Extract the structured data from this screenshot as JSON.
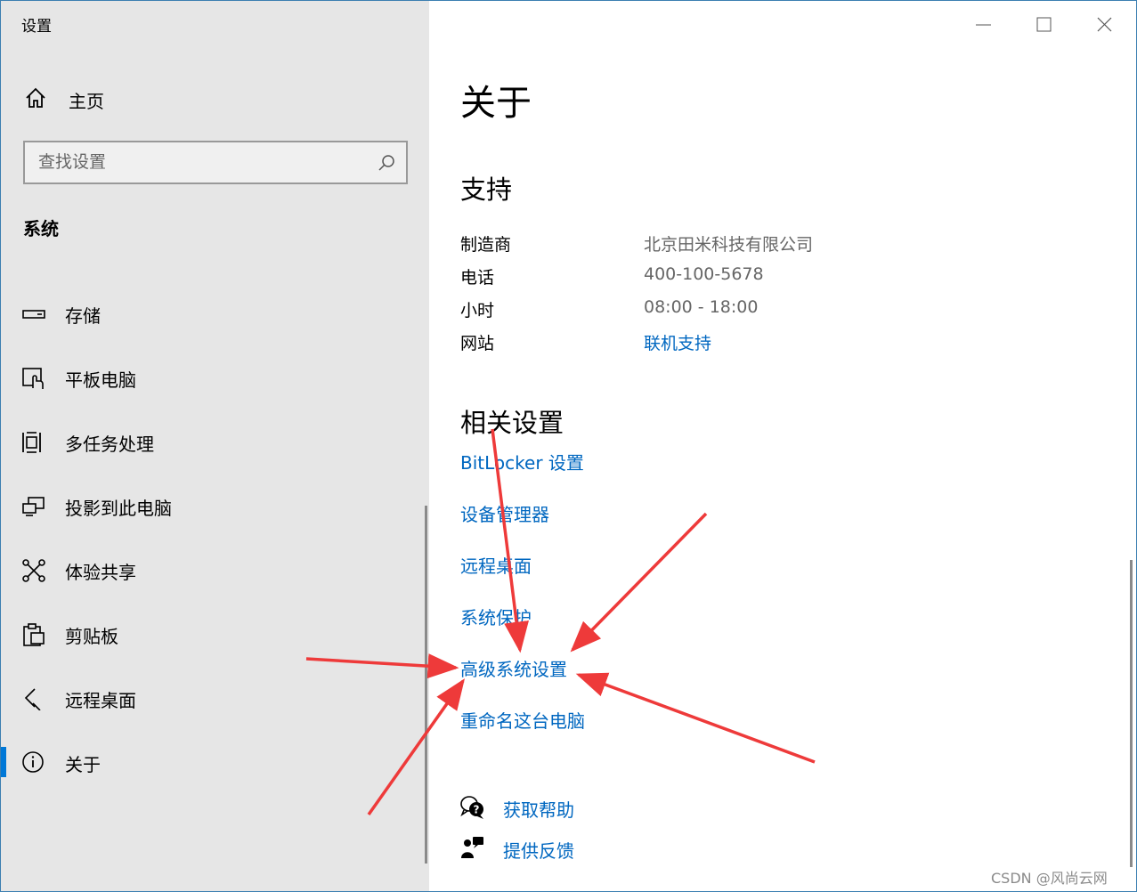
{
  "window": {
    "title": "设置",
    "controls": [
      "minimize-icon",
      "maximize-icon",
      "close-icon"
    ]
  },
  "sidebar": {
    "home_label": "主页",
    "search_placeholder": "查找设置",
    "section_title": "系统",
    "items": [
      {
        "label": "存储",
        "icon": "storage-icon"
      },
      {
        "label": "平板电脑",
        "icon": "tablet-icon"
      },
      {
        "label": "多任务处理",
        "icon": "multitasking-icon"
      },
      {
        "label": "投影到此电脑",
        "icon": "project-icon"
      },
      {
        "label": "体验共享",
        "icon": "shared-experiences-icon"
      },
      {
        "label": "剪贴板",
        "icon": "clipboard-icon"
      },
      {
        "label": "远程桌面",
        "icon": "remote-desktop-icon"
      },
      {
        "label": "关于",
        "icon": "info-icon",
        "active": true
      }
    ]
  },
  "main": {
    "title": "关于",
    "support": {
      "heading": "支持",
      "rows": [
        {
          "key": "制造商",
          "value": "北京田米科技有限公司"
        },
        {
          "key": "电话",
          "value": "400-100-5678"
        },
        {
          "key": "小时",
          "value": "08:00 - 18:00"
        },
        {
          "key": "网站",
          "value": "联机支持"
        }
      ]
    },
    "related": {
      "heading": "相关设置",
      "links": [
        "BitLocker 设置",
        "设备管理器",
        "远程桌面",
        "系统保护",
        "高级系统设置",
        "重命名这台电脑"
      ]
    },
    "help": [
      {
        "label": "获取帮助",
        "icon": "get-help-icon"
      },
      {
        "label": "提供反馈",
        "icon": "feedback-icon"
      }
    ]
  },
  "annotation": {
    "arrow_color": "#ee3a3a",
    "target": "高级系统设置"
  },
  "watermark": "CSDN @风尚云网",
  "colors": {
    "accent": "#0078d7",
    "link": "#0067c0",
    "sidebar_bg": "#e6e6e6"
  }
}
